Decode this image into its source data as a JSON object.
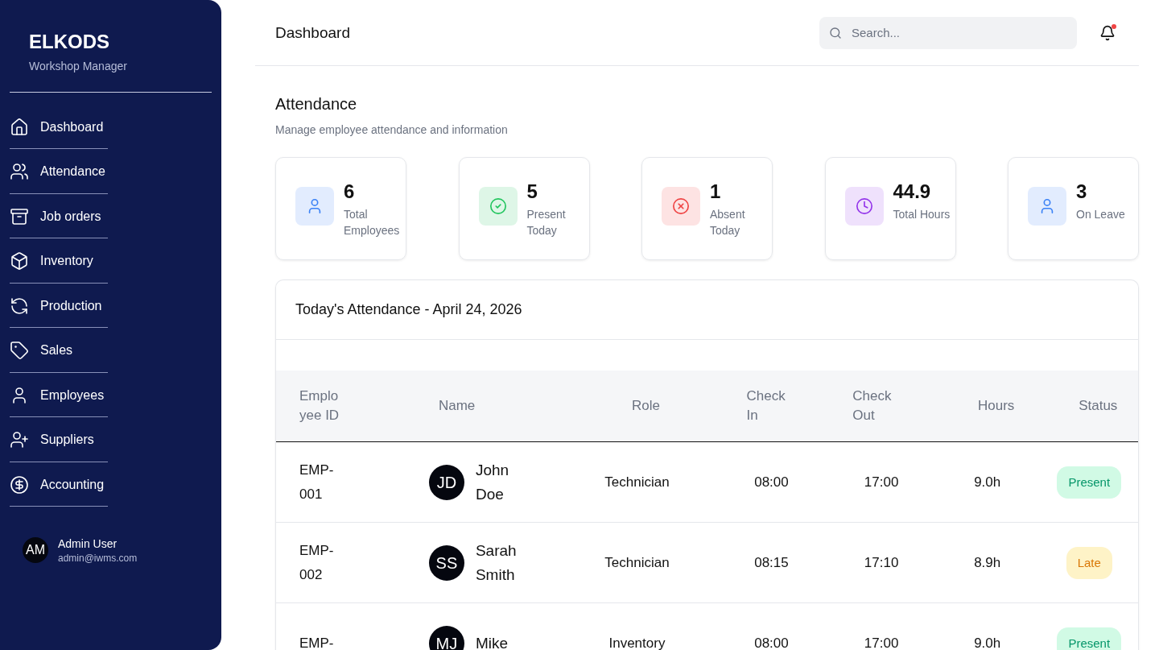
{
  "sidebar": {
    "brand": "ELKODS",
    "subtitle": "Workshop Manager",
    "items": [
      {
        "label": "Dashboard"
      },
      {
        "label": "Attendance"
      },
      {
        "label": "Job orders"
      },
      {
        "label": "Inventory"
      },
      {
        "label": "Production"
      },
      {
        "label": "Sales"
      },
      {
        "label": "Employees"
      },
      {
        "label": "Suppliers"
      },
      {
        "label": "Accounting"
      }
    ],
    "user": {
      "initials": "AM",
      "name": "Admin User",
      "email": "admin@iwms.com"
    }
  },
  "header": {
    "title": "Dashboard",
    "search": {
      "placeholder": "Search..."
    },
    "notification": true
  },
  "page": {
    "title": "Attendance",
    "subtitle": "Manage employee attendance and information"
  },
  "stats": [
    {
      "value": "6",
      "label": "Total Employees",
      "color": "#3b82f6"
    },
    {
      "value": "5",
      "label": "Present Today",
      "color": "#22c55e"
    },
    {
      "value": "1",
      "label": "Absent Today",
      "color": "#ef4444"
    },
    {
      "value": "44.9",
      "label": "Total Hours",
      "color": "#9333ea"
    },
    {
      "value": "3",
      "label": "On Leave",
      "color": "#3b82f6"
    }
  ],
  "table": {
    "title": "Today's Attendance - April 24, 2026",
    "columns": [
      "Emplo yee ID",
      "Name",
      "Role",
      "Check In",
      "Check Out",
      "Hours",
      "Status"
    ],
    "rows": [
      {
        "id": "EMP- 001",
        "initials": "JD",
        "name": "John Doe",
        "role": "Technician",
        "check_in": "08:00",
        "check_out": "17:00",
        "hours": "9.0h",
        "status": {
          "label": "Present",
          "kind": "present"
        }
      },
      {
        "id": "EMP- 002",
        "initials": "SS",
        "name": "Sarah Smith",
        "role": "Technician",
        "check_in": "08:15",
        "check_out": "17:10",
        "hours": "8.9h",
        "status": {
          "label": "Late",
          "kind": "late"
        }
      },
      {
        "id": "EMP-",
        "initials": "MJ",
        "name": "Mike",
        "role": "Inventory",
        "check_in": "08:00",
        "check_out": "17:00",
        "hours": "9.0h",
        "status": {
          "label": "Present",
          "kind": "present"
        }
      }
    ]
  }
}
